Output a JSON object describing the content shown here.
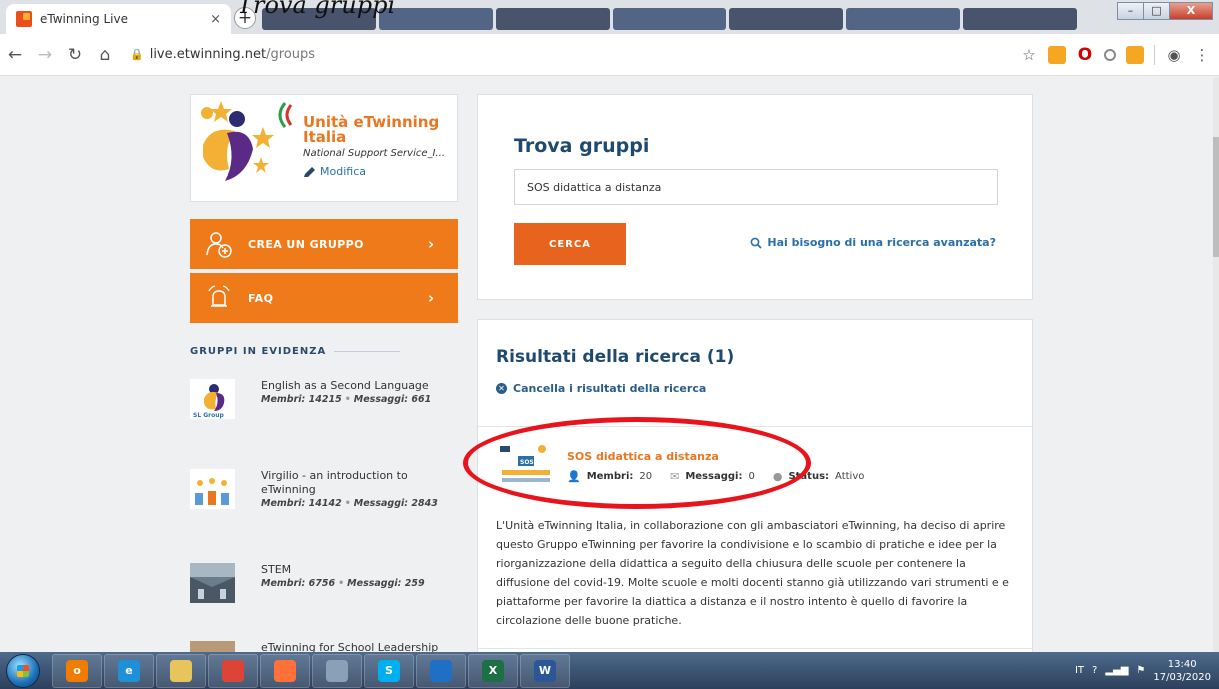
{
  "overlay_caption": "Trova gruppi",
  "browser": {
    "active_tab_title": "eTwinning Live",
    "close_tab": "×",
    "new_tab": "+",
    "url_host": "live.etwinning.net",
    "url_path": "/groups",
    "window_minimize": "–",
    "window_maximize": "□",
    "window_close": "X"
  },
  "profile": {
    "name": "Unità eTwinning Italia",
    "subtitle": "National Support Service_I...",
    "edit_label": "Modifica"
  },
  "buttons": {
    "create_group": "CREA UN GRUPPO",
    "faq": "FAQ",
    "arrow": "›"
  },
  "featured": {
    "heading": "GRUPPI IN EVIDENZA",
    "items": [
      {
        "name": "English as a Second Language",
        "stats": "Membri: 14215",
        "messages": "Messaggi: 661",
        "thumb_label": "SL Group"
      },
      {
        "name": "Virgilio - an introduction to eTwinning",
        "stats": "Membri: 14142",
        "messages": "Messaggi: 2843"
      },
      {
        "name": "STEM",
        "stats": "Membri: 6756",
        "messages": "Messaggi: 259"
      },
      {
        "name": "eTwinning for School Leadership"
      }
    ]
  },
  "search": {
    "title": "Trova gruppi",
    "query": "SOS didattica a distanza",
    "button": "CERCA",
    "advanced_link": "Hai bisogno di una ricerca avanzata?"
  },
  "results": {
    "title": "Risultati della ricerca (1)",
    "clear_label": "Cancella i risultati della ricerca",
    "item": {
      "name": "SOS didattica a distanza",
      "members_label": "Membri:",
      "members": "20",
      "messages_label": "Messaggi:",
      "messages": "0",
      "status_label": "Status:",
      "status": "Attivo",
      "description": "L'Unità eTwinning Italia, in collaborazione con gli ambasciatori eTwinning, ha deciso di aprire questo Gruppo eTwinning per favorire la condivisione e lo scambio di pratiche e idee per la riorganizzazione della didattica a seguito della chiusura delle scuole per contenere la diffusione del covid-19. Molte scuole e molti docenti stanno già utilizzando vari strumenti e e piattaforme per favorire la diattica a distanza e il nostro intento è quello di favorire la circolazione delle buone pratiche.",
      "thumb_label": "SOS"
    }
  },
  "taskbar": {
    "apps": [
      {
        "icon": "o",
        "color": "#f07d00"
      },
      {
        "icon": "e",
        "color": "#1e90d8"
      },
      {
        "icon": "",
        "color": "#e8c55a"
      },
      {
        "icon": "",
        "color": "#db4437"
      },
      {
        "icon": "",
        "color": "#ff7139"
      },
      {
        "icon": "",
        "color": "#8aa0b8"
      },
      {
        "icon": "S",
        "color": "#00aff0"
      },
      {
        "icon": "",
        "color": "#1f6fc5"
      },
      {
        "icon": "X",
        "color": "#1d7044"
      },
      {
        "icon": "W",
        "color": "#2b5797"
      }
    ],
    "language": "IT",
    "time": "13:40",
    "date": "17/03/2020"
  },
  "colors": {
    "orange": "#ef7a1a",
    "navy": "#1f4a6e",
    "link_blue": "#2a6fa8",
    "highlight_red": "#e8131b"
  }
}
